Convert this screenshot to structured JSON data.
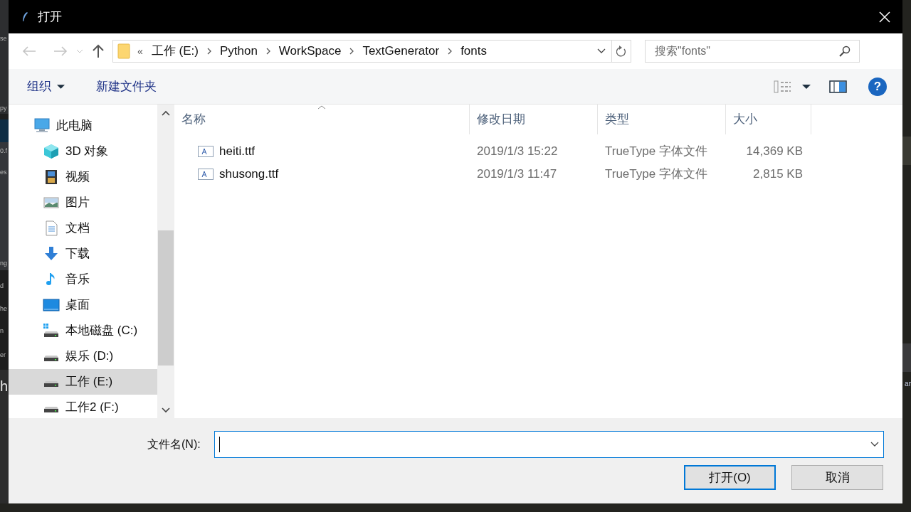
{
  "background_editor": {
    "left_fragments": [
      "se",
      "py",
      "0.f",
      "es",
      "ng",
      "d",
      "he",
      "n",
      "er",
      "h"
    ],
    "right_fragments": [
      "ar"
    ]
  },
  "window": {
    "title": "打开"
  },
  "address_bar": {
    "overflow": "«",
    "segments": [
      "工作 (E:)",
      "Python",
      "WorkSpace",
      "TextGenerator",
      "fonts"
    ]
  },
  "search": {
    "placeholder": "搜索\"fonts\""
  },
  "toolbar": {
    "organize": "组织",
    "new_folder": "新建文件夹",
    "help": "?"
  },
  "sidebar": {
    "items": [
      {
        "label": "此电脑",
        "kind": "computer",
        "selected": false,
        "children": [
          {
            "label": "3D 对象",
            "kind": "cube",
            "selected": false
          },
          {
            "label": "视频",
            "kind": "film",
            "selected": false
          },
          {
            "label": "图片",
            "kind": "picture",
            "selected": false
          },
          {
            "label": "文档",
            "kind": "document",
            "selected": false
          },
          {
            "label": "下载",
            "kind": "download",
            "selected": false
          },
          {
            "label": "音乐",
            "kind": "music",
            "selected": false
          },
          {
            "label": "桌面",
            "kind": "desktop",
            "selected": false
          },
          {
            "label": "本地磁盘 (C:)",
            "kind": "systemdrive",
            "selected": false
          },
          {
            "label": "娱乐 (D:)",
            "kind": "drive",
            "selected": false
          },
          {
            "label": "工作 (E:)",
            "kind": "drive",
            "selected": true
          },
          {
            "label": "工作2 (F:)",
            "kind": "drive",
            "selected": false
          }
        ]
      }
    ]
  },
  "file_list": {
    "columns": [
      {
        "label": "名称",
        "sorted": true
      },
      {
        "label": "修改日期",
        "sorted": false
      },
      {
        "label": "类型",
        "sorted": false
      },
      {
        "label": "大小",
        "sorted": false
      }
    ],
    "rows": [
      {
        "name": "heiti.ttf",
        "modified": "2019/1/3 15:22",
        "type": "TrueType 字体文件",
        "size": "14,369 KB"
      },
      {
        "name": "shusong.ttf",
        "modified": "2019/1/3 11:47",
        "type": "TrueType 字体文件",
        "size": "2,815 KB"
      }
    ]
  },
  "filename_field": {
    "label": "文件名(N):"
  },
  "buttons": [
    {
      "label": "打开(O)",
      "default": true
    },
    {
      "label": "取消",
      "default": false
    }
  ]
}
